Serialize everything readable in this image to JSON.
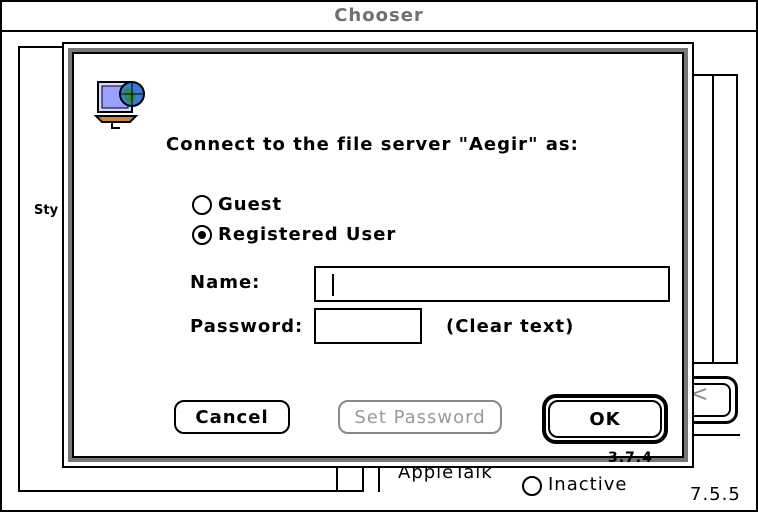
{
  "chooser": {
    "title": "Chooser",
    "partial_label_left": "Sty",
    "appletalk_label": "AppleTalk",
    "inactive_label": "Inactive",
    "version": "7.5.5",
    "setup_button_glyph": "<"
  },
  "dialog": {
    "icon": "file-server-icon",
    "prompt": "Connect to the file server \"Aegir\" as:",
    "options": {
      "guest": {
        "label": "Guest",
        "selected": false
      },
      "registered": {
        "label": "Registered User",
        "selected": true
      }
    },
    "name_label": "Name:",
    "name_value": "",
    "password_label": "Password:",
    "password_value": "",
    "password_note": "(Clear text)",
    "buttons": {
      "cancel": "Cancel",
      "set_password": "Set Password",
      "ok": "OK"
    },
    "version": "3.7.4"
  },
  "colors": {
    "frame_gray": "#777777",
    "title_gray": "#6f6f6f",
    "disabled_gray": "#999999"
  }
}
